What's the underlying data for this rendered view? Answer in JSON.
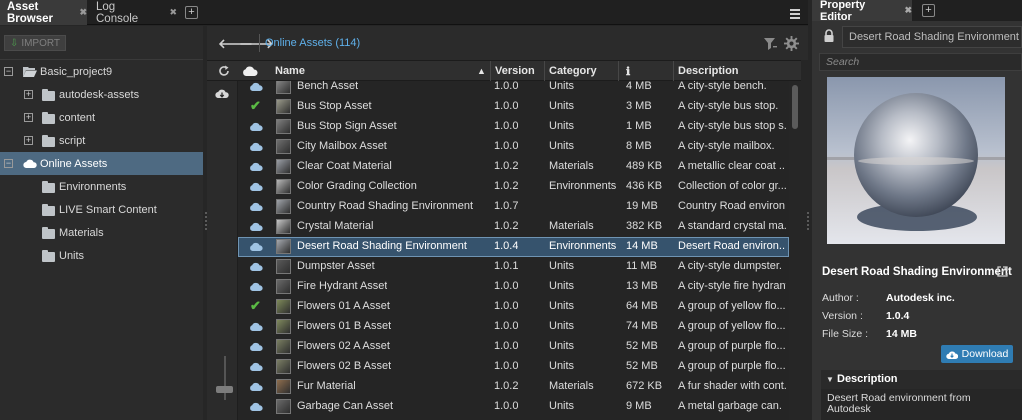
{
  "tabs": {
    "asset_browser": "Asset Browser",
    "log_console": "Log Console"
  },
  "left": {
    "import_label": "IMPORT",
    "tree": [
      {
        "label": "Basic_project9",
        "level": 0,
        "expander": "−",
        "icon": "folder-open-icon"
      },
      {
        "label": "autodesk-assets",
        "level": 1,
        "expander": "+",
        "icon": "folder-icon"
      },
      {
        "label": "content",
        "level": 1,
        "expander": "+",
        "icon": "folder-icon"
      },
      {
        "label": "script",
        "level": 1,
        "expander": "+",
        "icon": "folder-icon"
      },
      {
        "label": "Online Assets",
        "level": 0,
        "expander": "−",
        "icon": "cloud-icon",
        "selected": true
      },
      {
        "label": "Environments",
        "level": 1,
        "icon": "folder-icon"
      },
      {
        "label": "LIVE Smart Content",
        "level": 1,
        "icon": "folder-icon"
      },
      {
        "label": "Materials",
        "level": 1,
        "icon": "folder-icon"
      },
      {
        "label": "Units",
        "level": 1,
        "icon": "folder-icon"
      }
    ]
  },
  "center": {
    "path": "Online Assets (114)",
    "columns": {
      "name": "Name",
      "version": "Version",
      "category": "Category",
      "size": "ℹ",
      "description": "Description"
    },
    "rows": [
      {
        "status": "cloud",
        "thumb": "#8a8a8a",
        "name": "Bench Asset",
        "version": "1.0.0",
        "category": "Units",
        "size": "4 MB",
        "description": "A city-style bench."
      },
      {
        "status": "check",
        "thumb": "#9a9a8a",
        "name": "Bus Stop Asset",
        "version": "1.0.0",
        "category": "Units",
        "size": "3 MB",
        "description": "A city-style bus stop."
      },
      {
        "status": "cloud",
        "thumb": "#7f7f7f",
        "name": "Bus Stop Sign Asset",
        "version": "1.0.0",
        "category": "Units",
        "size": "1 MB",
        "description": "A city-style bus stop s..."
      },
      {
        "status": "cloud",
        "thumb": "#6f6f6f",
        "name": "City Mailbox Asset",
        "version": "1.0.0",
        "category": "Units",
        "size": "8 MB",
        "description": "A city-style mailbox."
      },
      {
        "status": "cloud",
        "thumb": "#9a9ea6",
        "name": "Clear Coat Material",
        "version": "1.0.2",
        "category": "Materials",
        "size": "489 KB",
        "description": "A metallic clear coat ..."
      },
      {
        "status": "cloud",
        "thumb": "#b8b8b8",
        "name": "Color Grading Collection",
        "version": "1.0.2",
        "category": "Environments",
        "size": "436 KB",
        "description": "Collection of color gr..."
      },
      {
        "status": "cloud",
        "thumb": "#a0a4aa",
        "name": "Country Road Shading Environment",
        "version": "1.0.7",
        "category": "",
        "size": "19 MB",
        "description": "Country Road environ..."
      },
      {
        "status": "cloud",
        "thumb": "#c8c8c8",
        "name": "Crystal Material",
        "version": "1.0.2",
        "category": "Materials",
        "size": "382 KB",
        "description": "A standard crystal ma..."
      },
      {
        "status": "cloud",
        "thumb": "#a4a8ae",
        "name": "Desert Road Shading Environment",
        "version": "1.0.4",
        "category": "Environments",
        "size": "14 MB",
        "description": "Desert Road environ...",
        "selected": true
      },
      {
        "status": "cloud",
        "thumb": "#5a5a5a",
        "name": "Dumpster Asset",
        "version": "1.0.1",
        "category": "Units",
        "size": "11 MB",
        "description": "A city-style dumpster."
      },
      {
        "status": "cloud",
        "thumb": "#6a6a6a",
        "name": "Fire Hydrant Asset",
        "version": "1.0.0",
        "category": "Units",
        "size": "13 MB",
        "description": "A city-style fire hydrant."
      },
      {
        "status": "check",
        "thumb": "#7e8a5a",
        "name": "Flowers 01 A Asset",
        "version": "1.0.0",
        "category": "Units",
        "size": "64 MB",
        "description": "A group of yellow flo..."
      },
      {
        "status": "cloud",
        "thumb": "#808a5e",
        "name": "Flowers 01 B Asset",
        "version": "1.0.0",
        "category": "Units",
        "size": "74 MB",
        "description": "A group of yellow flo..."
      },
      {
        "status": "cloud",
        "thumb": "#7a7f62",
        "name": "Flowers 02 A Asset",
        "version": "1.0.0",
        "category": "Units",
        "size": "52 MB",
        "description": "A group of purple flo..."
      },
      {
        "status": "cloud",
        "thumb": "#7c7f66",
        "name": "Flowers 02 B Asset",
        "version": "1.0.0",
        "category": "Units",
        "size": "52 MB",
        "description": "A group of purple flo..."
      },
      {
        "status": "cloud",
        "thumb": "#8f6e4e",
        "name": "Fur Material",
        "version": "1.0.2",
        "category": "Materials",
        "size": "672 KB",
        "description": "A fur shader with cont..."
      },
      {
        "status": "cloud",
        "thumb": "#6a6a6a",
        "name": "Garbage Can Asset",
        "version": "1.0.0",
        "category": "Units",
        "size": "9 MB",
        "description": "A metal garbage can."
      }
    ]
  },
  "property_editor": {
    "tab_label": "Property Editor",
    "name_field": "Desert Road Shading Environment",
    "search_placeholder": "Search",
    "asset_title": "Desert Road Shading Environment",
    "author_label": "Author :",
    "author_value": "Autodesk inc.",
    "version_label": "Version :",
    "version_value": "1.0.4",
    "filesize_label": "File Size :",
    "filesize_value": "14 MB",
    "download_label": "Download",
    "description_header": "Description",
    "description_text": "Desert Road environment from Autodesk"
  },
  "colors": {
    "accent_link": "#5fb0ea",
    "selection": "#36536d",
    "tree_selection": "#4e6a82",
    "check_green": "#5aba44",
    "download_blue": "#2f7cb3"
  }
}
